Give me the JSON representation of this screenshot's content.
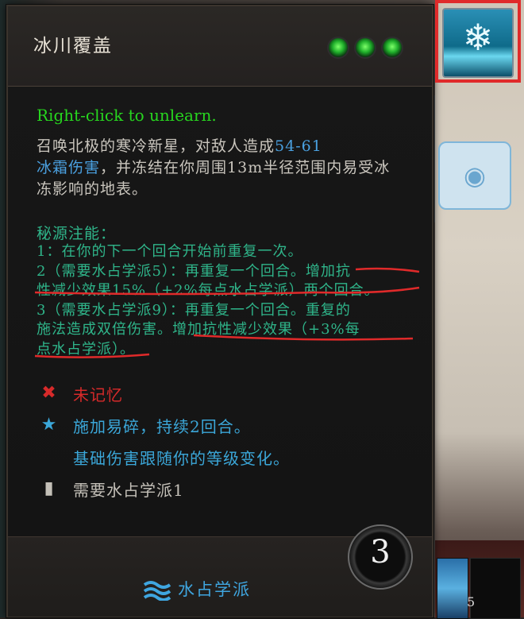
{
  "skill": {
    "title": "冰川覆盖",
    "action_points": 3,
    "unlearn_hint": "Right-click to unlearn.",
    "description": {
      "part1": "召唤北极的寒冷新星，对敌人造成",
      "damage_range": "54-61",
      "damage_type": "冰霜伤害",
      "part2": "，并冻结在你周围13m半径范围内易受冰冻影响的地表。"
    },
    "source_infusions": {
      "heading": "秘源注能：",
      "lines": [
        "1：在你的下一个回合开始前重复一次。",
        "2（需要水占学派5）：再重复一个回合。增加抗",
        "性减少效果15%（+2%每点水占学派）两个回合。",
        "3（需要水占学派9）：再重复一个回合。重复的",
        "施法造成双倍伤害。增加抗性减少效果（+3%每",
        "点水占学派）。"
      ]
    },
    "status": {
      "not_memorized": "未记忆",
      "applies": "施加易碎，持续2回合。",
      "scaling": "基础伤害跟随你的等级变化。",
      "requirement": "需要水占学派1"
    },
    "school": "水占学派",
    "cooldown": "3"
  },
  "side": {
    "slot_number": "5",
    "icons": {
      "skill": "snowflake-icon",
      "memory_button": "brain-icon"
    }
  },
  "colors": {
    "highlight_frame": "#e02a2a",
    "unlearn": "#27d61f",
    "source": "#2fb58a",
    "water": "#3ba7d9",
    "ap": "#2fb83a"
  }
}
